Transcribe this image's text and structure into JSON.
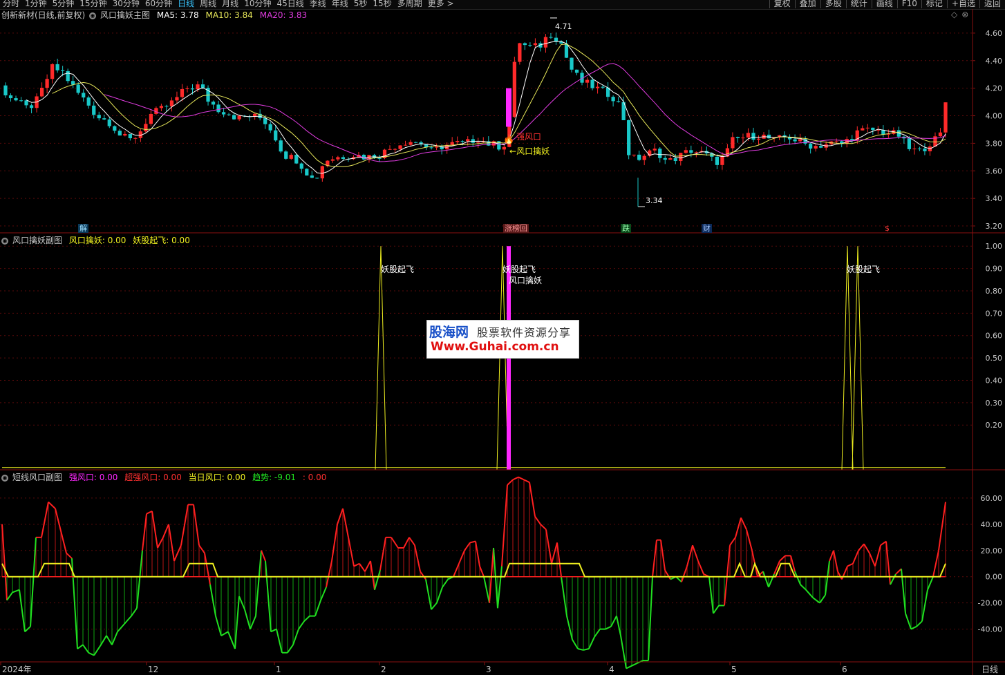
{
  "topbar": {
    "periods": [
      "分时",
      "1分钟",
      "5分钟",
      "15分钟",
      "30分钟",
      "60分钟",
      "日线",
      "周线",
      "月线",
      "10分钟",
      "45日线",
      "季线",
      "年线",
      "5秒",
      "15秒",
      "多周期",
      "更多 >"
    ],
    "active_period": "日线",
    "tools": [
      "复权",
      "叠加",
      "多股",
      "统计",
      "画线",
      "F10",
      "标记",
      "+自选",
      "返回"
    ]
  },
  "main_panel": {
    "stock_label": "创新新材(日线,前复权)",
    "indicator_name": "风口擒妖主图",
    "ma5_label": "MA5: 3.78",
    "ma10_label": "MA10: 3.84",
    "ma20_label": "MA20: 3.83",
    "high_label": "4.71",
    "low_label": "3.34",
    "signal_label_1": "强风口",
    "signal_label_2": "风口擒妖",
    "events": [
      "解",
      "涨榜回",
      "跌",
      "财",
      "$"
    ],
    "y_ticks": [
      "4.60",
      "4.40",
      "4.20",
      "4.00",
      "3.80",
      "3.60",
      "3.40",
      "3.20"
    ]
  },
  "sub1": {
    "name": "风口擒妖副图",
    "v1": "风口擒妖: 0.00",
    "v2": "妖股起飞: 0.00",
    "label_a": "妖股起飞",
    "label_b": "妖股起飞",
    "label_c": "风口擒妖",
    "label_d": "妖股起飞",
    "y_ticks": [
      "1.00",
      "0.90",
      "0.80",
      "0.70",
      "0.60",
      "0.50",
      "0.40",
      "0.30",
      "0.20"
    ]
  },
  "sub2": {
    "name": "短线风口副图",
    "v1": "强风口: 0.00",
    "v2": "超强风口: 0.00",
    "v3": "当日风口: 0.00",
    "v4": "趋势: -9.01",
    "v5": ": 0.00",
    "y_ticks": [
      "60.00",
      "40.00",
      "20.00",
      "0.00",
      "-20.00",
      "-40.00"
    ]
  },
  "x_axis": {
    "labels": [
      "2024年",
      "12",
      "1",
      "2",
      "3",
      "4",
      "5",
      "6"
    ],
    "period_box": "日线"
  },
  "watermark": {
    "brand": "股海网",
    "slogan": "股票软件资源分享",
    "url": "Www.Guhai.com.cn"
  },
  "colors": {
    "up": "#ff2a2a",
    "down": "#19c8c8",
    "ma5": "#ffffff",
    "ma10": "#e8e85a",
    "ma20": "#e03ce0",
    "pos_line": "#ff2020",
    "neg_line": "#20e020",
    "yellow": "#f0f020",
    "magenta": "#ff28ff"
  },
  "chart_data": [
    {
      "type": "candlestick",
      "title": "风口擒妖主图",
      "ylim": [
        3.15,
        4.75
      ],
      "series": [
        {
          "name": "MA5",
          "value": 3.78
        },
        {
          "name": "MA10",
          "value": 3.84
        },
        {
          "name": "MA20",
          "value": 3.83
        }
      ],
      "annotations": [
        {
          "text": "4.71",
          "value": 4.71
        },
        {
          "text": "3.34",
          "value": 3.34
        }
      ]
    },
    {
      "type": "line",
      "title": "风口擒妖副图",
      "ylim": [
        0,
        1
      ],
      "series": [
        {
          "name": "风口擒妖"
        },
        {
          "name": "妖股起飞"
        }
      ]
    },
    {
      "type": "bar",
      "title": "短线风口副图",
      "ylim": [
        -65,
        80
      ],
      "series": [
        {
          "name": "强风口"
        },
        {
          "name": "超强风口"
        },
        {
          "name": "当日风口"
        },
        {
          "name": "趋势",
          "value": -9.01
        }
      ]
    }
  ]
}
